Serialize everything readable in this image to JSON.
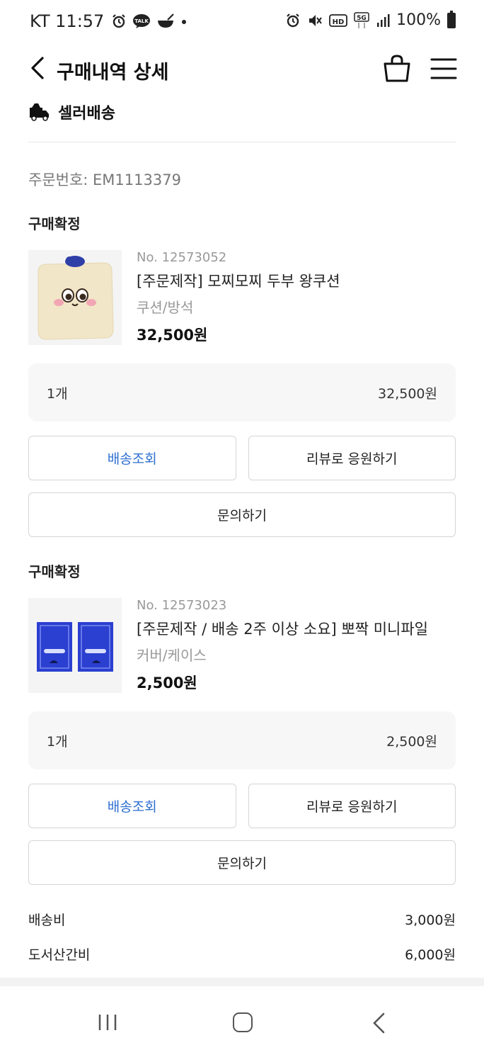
{
  "status_bar": {
    "carrier_time": "KT 11:57",
    "battery": "100%"
  },
  "header": {
    "title": "구매내역 상세"
  },
  "seller": {
    "label": "셀러배송"
  },
  "order": {
    "number": "주문번호: EM1113379"
  },
  "items": [
    {
      "status": "구매확정",
      "no": "No. 12573052",
      "name": "[주문제작] 모찌모찌 두부 왕쿠션",
      "category": "쿠션/방석",
      "price": "32,500원",
      "qty": "1개",
      "qty_price": "32,500원",
      "btn_track": "배송조회",
      "btn_review": "리뷰로 응원하기",
      "btn_inquiry": "문의하기"
    },
    {
      "status": "구매확정",
      "no": "No. 12573023",
      "name": "[주문제작 / 배송 2주 이상 소요] 뽀짝 미니파일",
      "category": "커버/케이스",
      "price": "2,500원",
      "qty": "1개",
      "qty_price": "2,500원",
      "btn_track": "배송조회",
      "btn_review": "리뷰로 응원하기",
      "btn_inquiry": "문의하기"
    }
  ],
  "fees": {
    "shipping_label": "배송비",
    "shipping_value": "3,000원",
    "remote_label": "도서산간비",
    "remote_value": "6,000원"
  },
  "colors": {
    "accent_blue": "#2d6fd1",
    "file_blue": "#2b3fd0"
  }
}
